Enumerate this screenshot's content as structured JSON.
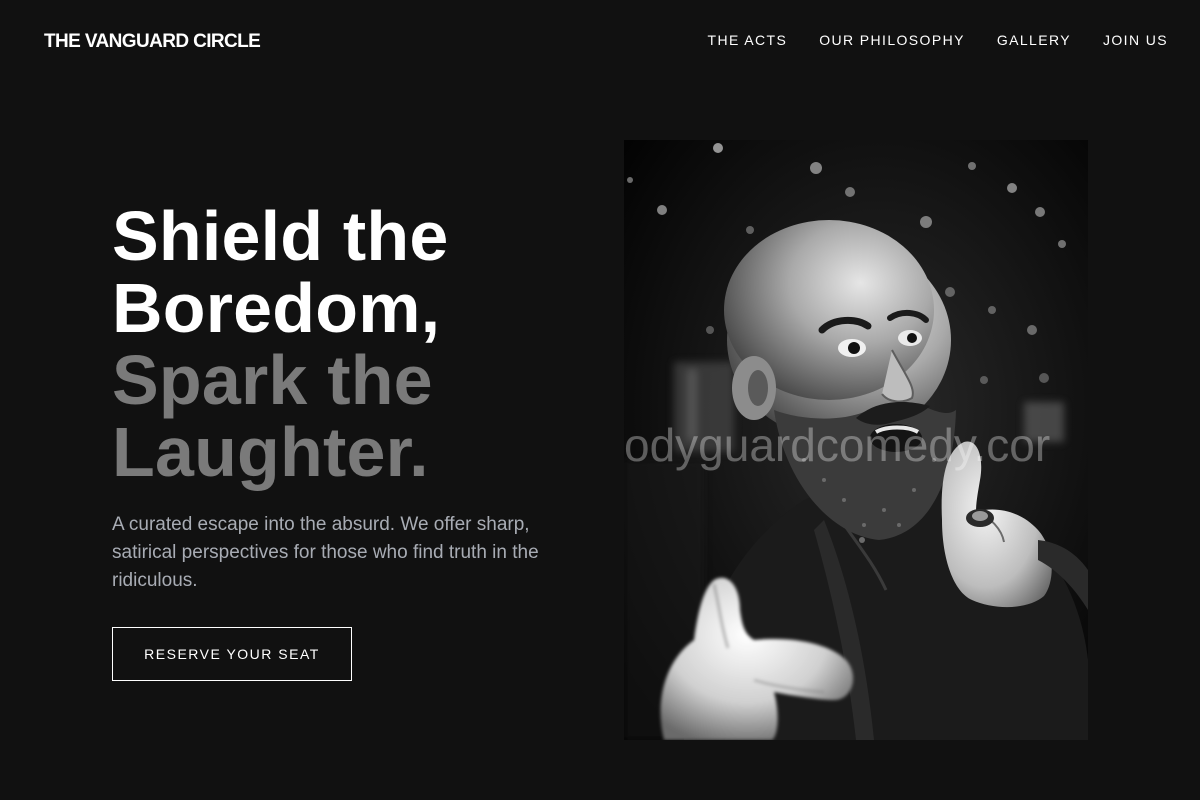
{
  "header": {
    "brand": "THE VANGUARD CIRCLE",
    "nav": [
      {
        "label": "THE ACTS"
      },
      {
        "label": "OUR PHILOSOPHY"
      },
      {
        "label": "GALLERY"
      },
      {
        "label": "JOIN US"
      }
    ]
  },
  "hero": {
    "title_line1": "Shield the",
    "title_line2": "Boredom,",
    "title_line3": "Spark the",
    "title_line4": "Laughter.",
    "subtitle": "A curated escape into the absurd. We offer sharp, satirical perspectives for those who find truth in the ridiculous.",
    "cta_label": "RESERVE YOUR SEAT"
  },
  "photo": {
    "watermark": "odyguardcomedy.cor"
  },
  "colors": {
    "background": "#111111",
    "text_primary": "#ffffff",
    "title_dim": "#7a7a7a",
    "subtitle": "#a8acb4"
  }
}
